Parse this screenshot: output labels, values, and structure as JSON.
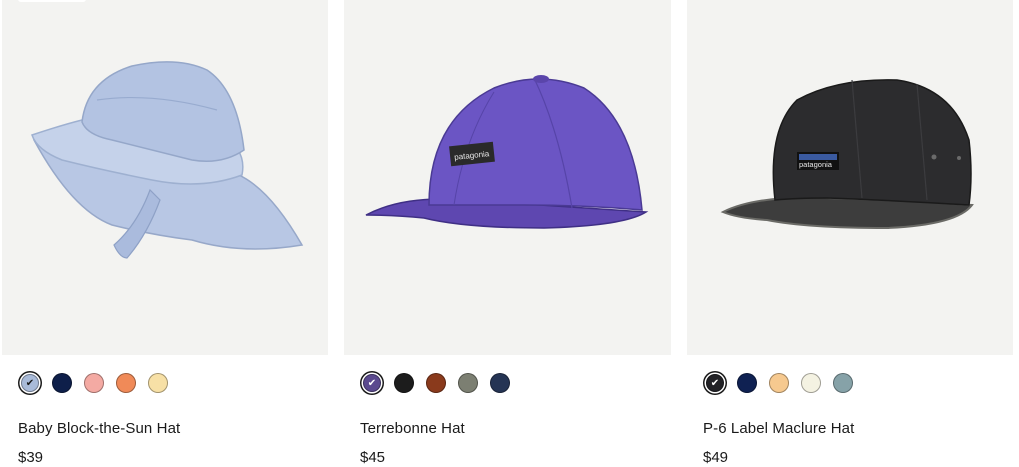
{
  "products": [
    {
      "name": "Baby Block-the-Sun Hat",
      "price": "$39",
      "image_icon": "bucket-sun-hat-image",
      "swatches": [
        {
          "color": "#a9bbd9",
          "selected": true
        },
        {
          "color": "#0e1f4a",
          "selected": false
        },
        {
          "color": "#f4aaa3",
          "selected": false
        },
        {
          "color": "#f08a58",
          "selected": false
        },
        {
          "color": "#f7e0a6",
          "selected": false
        }
      ]
    },
    {
      "name": "Terrebonne Hat",
      "price": "$45",
      "image_icon": "purple-cap-image",
      "swatches": [
        {
          "color": "#5b4a8f",
          "selected": true
        },
        {
          "color": "#1c1c1c",
          "selected": false
        },
        {
          "color": "#8a3a1c",
          "selected": false
        },
        {
          "color": "#7c7f72",
          "selected": false
        },
        {
          "color": "#253454",
          "selected": false
        }
      ]
    },
    {
      "name": "P-6 Label Maclure Hat",
      "price": "$49",
      "image_icon": "black-five-panel-cap-image",
      "swatches": [
        {
          "color": "#222226",
          "selected": true
        },
        {
          "color": "#0f2152",
          "selected": false
        },
        {
          "color": "#f6c98f",
          "selected": false
        },
        {
          "color": "#f4f2e2",
          "selected": false
        },
        {
          "color": "#86a2a8",
          "selected": false
        }
      ]
    }
  ]
}
